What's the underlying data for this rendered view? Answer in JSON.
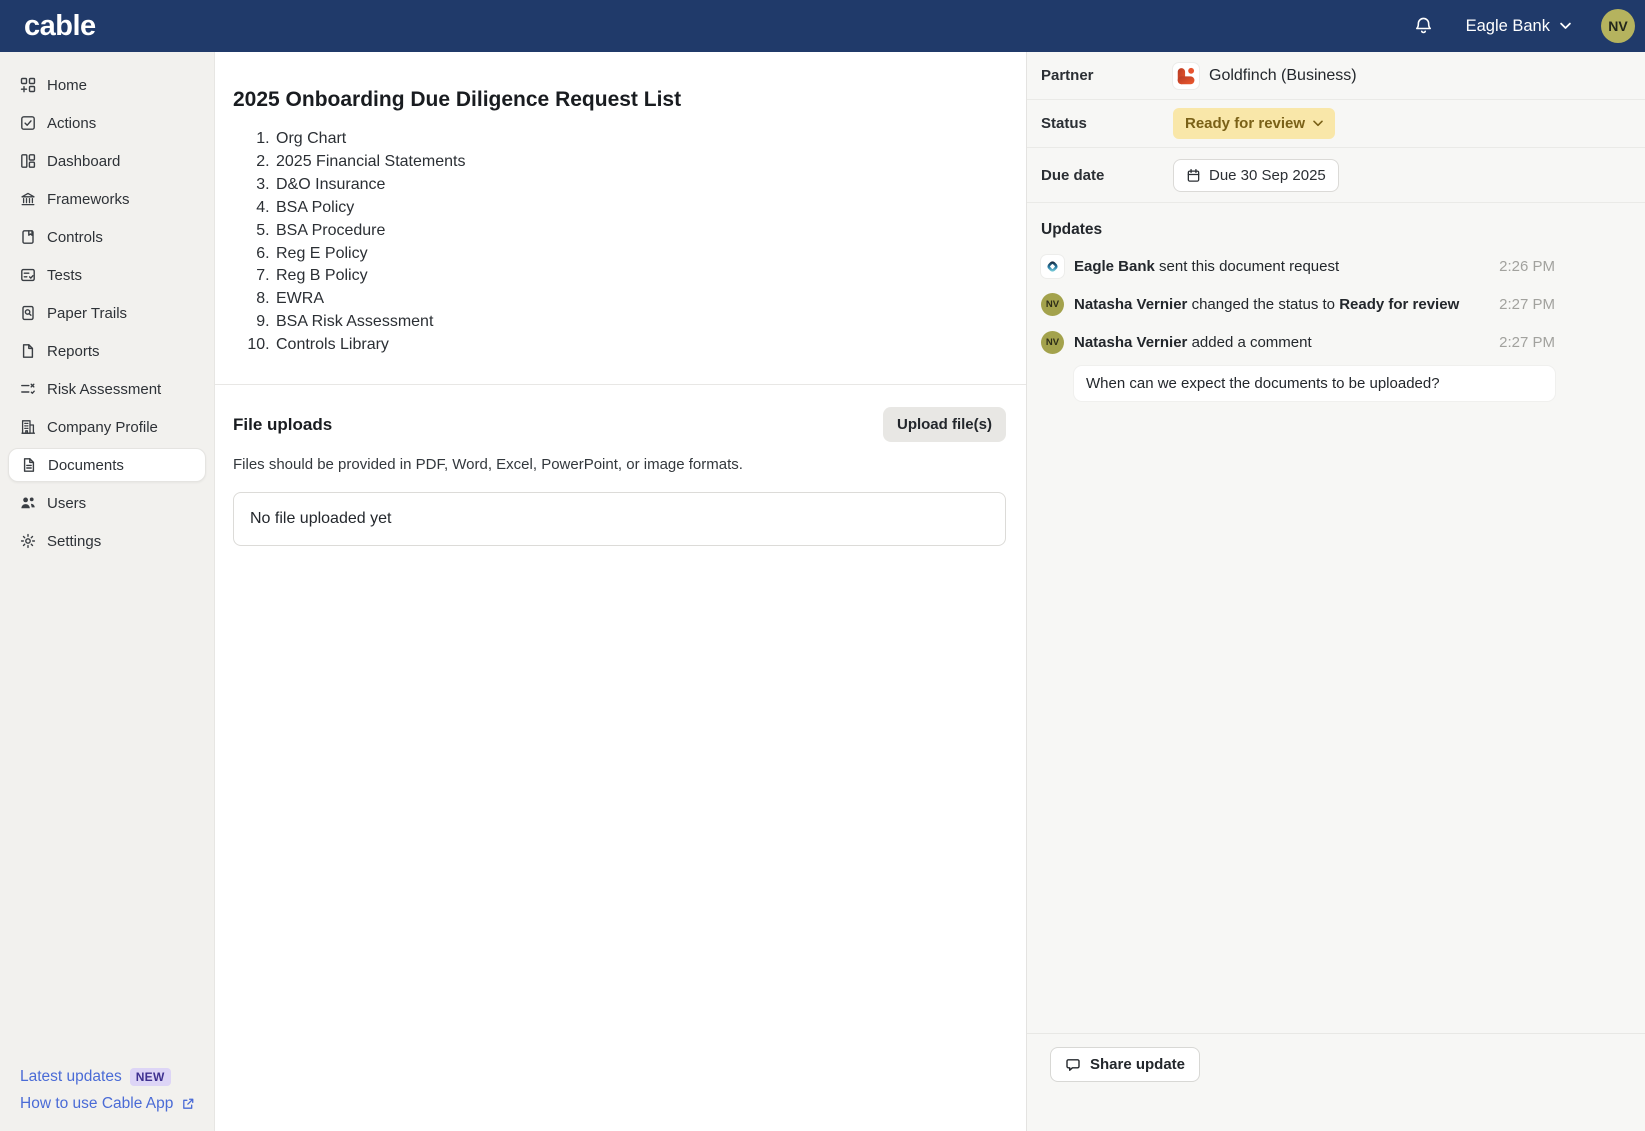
{
  "header": {
    "logo_text": "cable",
    "org_name": "Eagle Bank",
    "avatar_initials": "NV"
  },
  "sidebar": {
    "items": [
      {
        "label": "Home",
        "selected": false
      },
      {
        "label": "Actions",
        "selected": false
      },
      {
        "label": "Dashboard",
        "selected": false
      },
      {
        "label": "Frameworks",
        "selected": false
      },
      {
        "label": "Controls",
        "selected": false
      },
      {
        "label": "Tests",
        "selected": false
      },
      {
        "label": "Paper Trails",
        "selected": false
      },
      {
        "label": "Reports",
        "selected": false
      },
      {
        "label": "Risk Assessment",
        "selected": false
      },
      {
        "label": "Company Profile",
        "selected": false
      },
      {
        "label": "Documents",
        "selected": true
      },
      {
        "label": "Users",
        "selected": false
      },
      {
        "label": "Settings",
        "selected": false
      }
    ],
    "footer": {
      "latest_updates_label": "Latest updates",
      "new_badge": "NEW",
      "help_link_label": "How to use Cable App"
    }
  },
  "main": {
    "title": "2025 Onboarding Due Diligence Request List",
    "request_items": [
      "Org Chart",
      "2025 Financial Statements",
      "D&O Insurance",
      "BSA Policy",
      "BSA Procedure",
      "Reg E Policy",
      "Reg B Policy",
      "EWRA",
      "BSA Risk Assessment",
      "Controls Library"
    ],
    "file_uploads": {
      "title": "File uploads",
      "upload_button_label": "Upload file(s)",
      "hint": "Files should be provided in PDF, Word, Excel, PowerPoint, or image formats.",
      "empty_state": "No file uploaded yet"
    }
  },
  "details_panel": {
    "partner_label": "Partner",
    "partner_value": "Goldfinch (Business)",
    "status_label": "Status",
    "status_value": "Ready for review",
    "due_date_label": "Due date",
    "due_date_value": "Due 30 Sep 2025",
    "updates": {
      "title": "Updates",
      "entries": [
        {
          "actor": "Eagle Bank",
          "action": " sent this document request",
          "emphasis": "",
          "time": "2:26 PM"
        },
        {
          "actor": "Natasha Vernier",
          "action": " changed the status to ",
          "emphasis": "Ready for review",
          "time": "2:27 PM"
        },
        {
          "actor": "Natasha Vernier",
          "action": " added a comment",
          "emphasis": "",
          "time": "2:27 PM"
        }
      ],
      "comment": "When can we expect the documents to be uploaded?",
      "avatar_initials": "NV"
    },
    "share_update_label": "Share update"
  },
  "colors": {
    "navbar_bg": "#203a6a",
    "sidebar_bg": "#f2f1ee",
    "panel_bg": "#f7f7f5",
    "status_badge_bg": "#f9e7a9",
    "status_badge_text": "#7a6118",
    "avatar_bg": "#b5b35e",
    "link_blue": "#4a6bd6",
    "new_badge_bg": "#ddd5f6",
    "new_badge_text": "#3f3190",
    "partner_logo_red": "#d64327"
  }
}
